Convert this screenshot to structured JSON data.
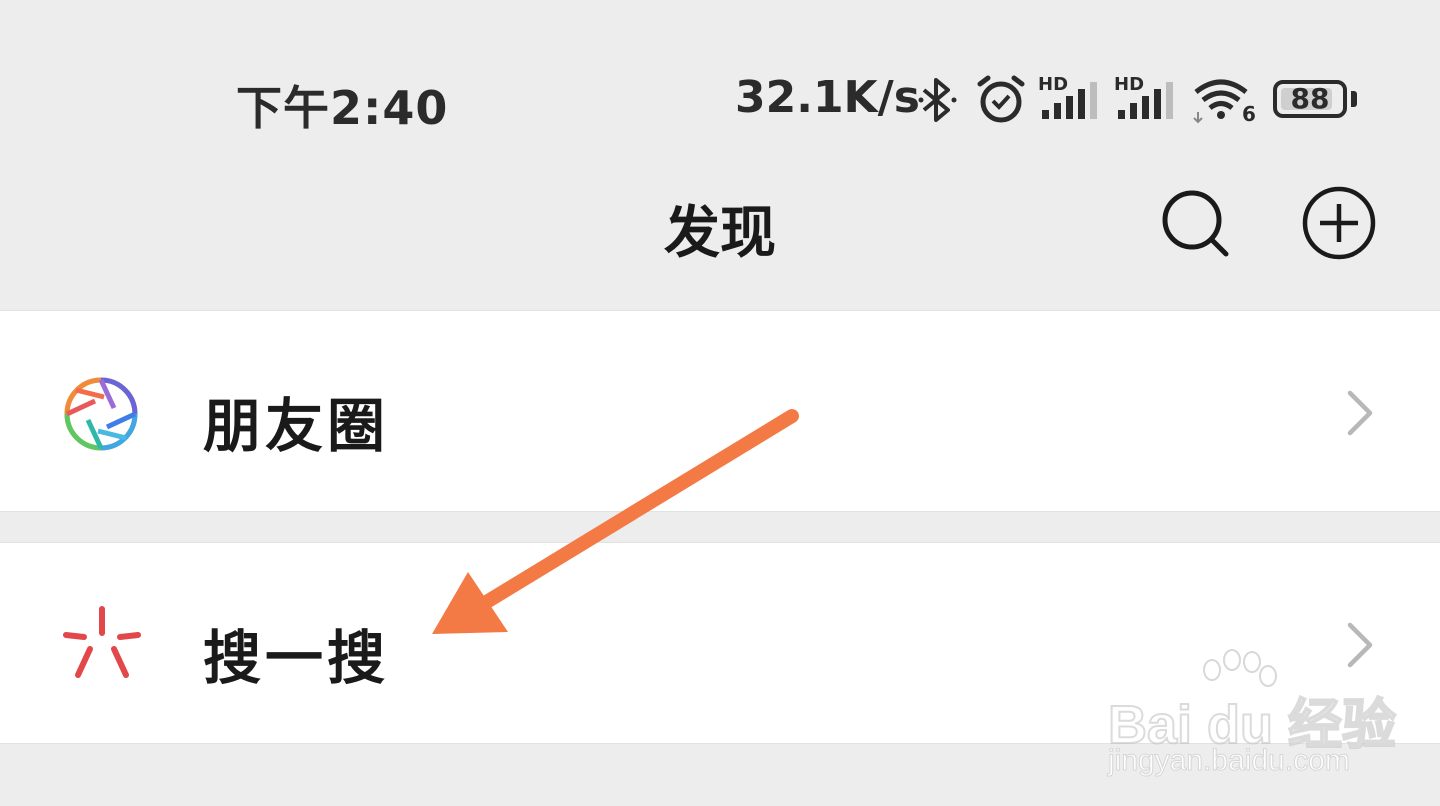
{
  "status_bar": {
    "time": "下午2:40",
    "net_speed": "32.1K/s",
    "battery_level": 88,
    "battery_text": "88",
    "signal_1_label": "HD",
    "signal_2_label": "HD",
    "wifi_label": "6",
    "icons": [
      "bluetooth-icon",
      "alarm-icon",
      "signal-icon",
      "signal-icon",
      "wifi-icon",
      "battery-icon"
    ]
  },
  "nav": {
    "title": "发现",
    "search_icon": "search-icon",
    "add_icon": "add-circle-icon"
  },
  "list": [
    {
      "label": "朋友圈",
      "icon": "moments-aperture-icon"
    },
    {
      "label": "搜一搜",
      "icon": "search-burst-icon"
    }
  ],
  "watermark": {
    "main": "Bai du 经验",
    "sub": "jingyan.baidu.com"
  },
  "colors": {
    "background": "#ededed",
    "row": "#ffffff",
    "annotation_arrow": "#f47a45",
    "search_burst_red": "#e2474a"
  }
}
